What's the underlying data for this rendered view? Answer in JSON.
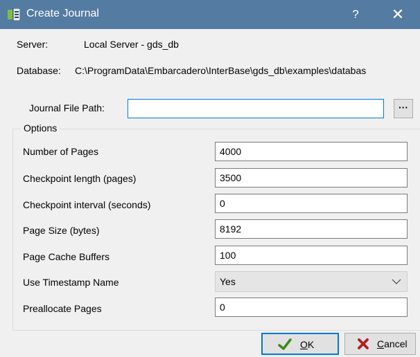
{
  "window": {
    "title": "Create Journal",
    "help": "?",
    "close": "✕"
  },
  "server": {
    "label": "Server:",
    "value": "Local Server - gds_db"
  },
  "database": {
    "label": "Database:",
    "value": "C:\\ProgramData\\Embarcadero\\InterBase\\gds_db\\examples\\databas"
  },
  "journal": {
    "label": "Journal File Path:",
    "value": "",
    "browse": "···"
  },
  "options": {
    "label": "Options",
    "rows": [
      {
        "label": "Number of Pages",
        "value": "4000"
      },
      {
        "label": "Checkpoint length (pages)",
        "value": "3500"
      },
      {
        "label": "Checkpoint interval (seconds)",
        "value": "0"
      },
      {
        "label": "Page Size (bytes)",
        "value": "8192"
      },
      {
        "label": "Page Cache Buffers",
        "value": "100"
      },
      {
        "label": "Use Timestamp Name",
        "value": "Yes"
      },
      {
        "label": "Preallocate Pages",
        "value": "0"
      }
    ]
  },
  "buttons": {
    "ok": {
      "accel": "O",
      "rest": "K"
    },
    "cancel": {
      "accel": "C",
      "rest": "ancel"
    }
  },
  "colors": {
    "titlebar": "#547ba1",
    "focus": "#0078d7",
    "ok_check": "#3a8a1a",
    "cancel_x": "#b22020"
  }
}
